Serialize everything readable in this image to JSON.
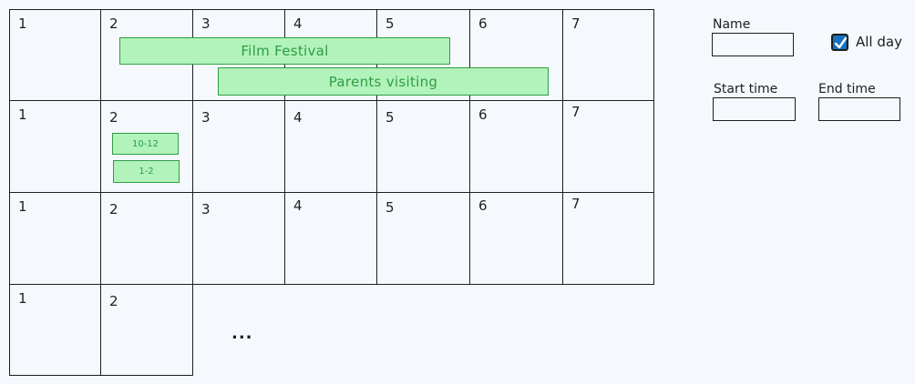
{
  "calendar": {
    "rows": [
      [
        "1",
        "2",
        "3",
        "4",
        "5",
        "6",
        "7"
      ],
      [
        "1",
        "2",
        "3",
        "4",
        "5",
        "6",
        "7"
      ],
      [
        "1",
        "2",
        "3",
        "4",
        "5",
        "6",
        "7"
      ],
      [
        "1",
        "2"
      ]
    ],
    "events": {
      "film_festival": "Film Festival",
      "parents_visiting": "Parents visiting",
      "slot_1": "10-12",
      "slot_2": "1-2"
    },
    "ellipsis": "..."
  },
  "form": {
    "name_label": "Name",
    "name_value": "",
    "all_day_label": "All day",
    "all_day_checked": true,
    "start_time_label": "Start time",
    "start_time_value": "",
    "end_time_label": "End time",
    "end_time_value": "",
    "accent_color": "#1971c2",
    "event_fill_color": "#b2f2bb",
    "event_text_color": "#2f9e44"
  }
}
